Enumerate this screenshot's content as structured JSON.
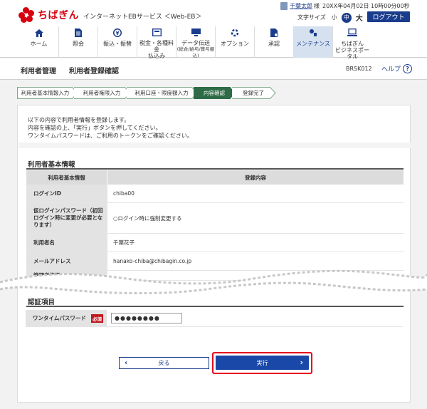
{
  "brand": {
    "logo_text": "ちばぎん",
    "service": "インターネットEBサービス ＜Web-EB＞",
    "accent": "#d7000f",
    "navy": "#1a3c8c"
  },
  "user": {
    "name": "千葉太郎",
    "honorific": "様",
    "datetime": "20XX年04月02日 10時00分00秒"
  },
  "font_size": {
    "label": "文字サイズ",
    "small": "小",
    "medium": "中",
    "large": "大"
  },
  "logout_label": "ログアウト",
  "nav": [
    {
      "label": "ホーム",
      "icon": "home-icon"
    },
    {
      "label": "照会",
      "icon": "document-icon"
    },
    {
      "label": "振込・振替",
      "icon": "transfer-icon"
    },
    {
      "label": "税金・各種料金",
      "sub": "払込み",
      "icon": "tax-payment-icon"
    },
    {
      "label": "データ伝送",
      "sub": "(総合/給与/賞与振込)",
      "icon": "data-transmission-icon"
    },
    {
      "label": "オプション",
      "icon": "option-icon"
    },
    {
      "label": "承認",
      "icon": "approval-icon"
    },
    {
      "label": "メンテナンス",
      "icon": "maintenance-icon"
    },
    {
      "label": "ちばぎん",
      "sub": "ビジネスポータル",
      "icon": "portal-icon"
    }
  ],
  "page": {
    "title": "利用者管理",
    "subtitle": "利用者登録確認",
    "code": "BRSK012",
    "help": "ヘルプ"
  },
  "steps": [
    "利用者基本情報入力",
    "利用者権限入力",
    "利用口座・限度額入力",
    "内容確認",
    "登録完了"
  ],
  "intro": [
    "以下の内容で利用者情報を登録します。",
    "内容を確認の上、「実行」ボタンを押してください。",
    "ワンタイムパスワードは、ご利用のトークンをご確認ください。"
  ],
  "basic": {
    "section_title": "利用者基本情報",
    "head_key": "利用者基本情報",
    "head_value": "登録内容",
    "rows": [
      {
        "key": "ログインID",
        "value": "chiba00"
      },
      {
        "key": "仮ログインパスワード（初回ログイン時に変更が必要となります）",
        "value": "○ログイン時に強制変更する"
      },
      {
        "key": "利用者名",
        "value": "千葉花子"
      },
      {
        "key": "メールアドレス",
        "value": "hanako-chiba@chibagin.co.jp"
      },
      {
        "key": "管理者権限",
        "value": ""
      }
    ]
  },
  "auth": {
    "section_title": "認証項目",
    "key": "ワンタイムパスワード",
    "required": "必須",
    "value": "●●●●●●●●"
  },
  "buttons": {
    "back": "戻る",
    "execute": "実行"
  }
}
